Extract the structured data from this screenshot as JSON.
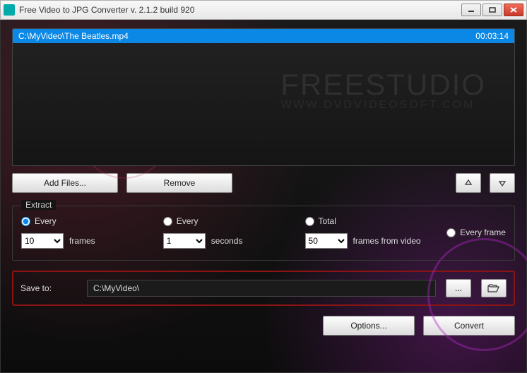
{
  "window": {
    "title": "Free Video to JPG Converter  v. 2.1.2 build 920"
  },
  "file": {
    "path": "C:\\MyVideo\\The Beatles.mp4",
    "duration": "00:03:14"
  },
  "watermark": {
    "big": "FREESTUDIO",
    "small": "WWW.DVDVIDEOSOFT.COM"
  },
  "buttons": {
    "add_files": "Add Files...",
    "remove": "Remove",
    "options": "Options...",
    "convert": "Convert",
    "browse": "...",
    "open_folder_icon": "open-folder",
    "up_icon": "arrow-up",
    "down_icon": "arrow-down"
  },
  "extract": {
    "group_label": "Extract",
    "every_frames": {
      "label": "Every",
      "value": "10",
      "unit": "frames",
      "selected": true
    },
    "every_seconds": {
      "label": "Every",
      "value": "1",
      "unit": "seconds",
      "selected": false
    },
    "total": {
      "label": "Total",
      "value": "50",
      "unit": "frames from video",
      "selected": false
    },
    "every_frame": {
      "label": "Every frame",
      "selected": false
    }
  },
  "save": {
    "label": "Save to:",
    "path": "C:\\MyVideo\\"
  }
}
